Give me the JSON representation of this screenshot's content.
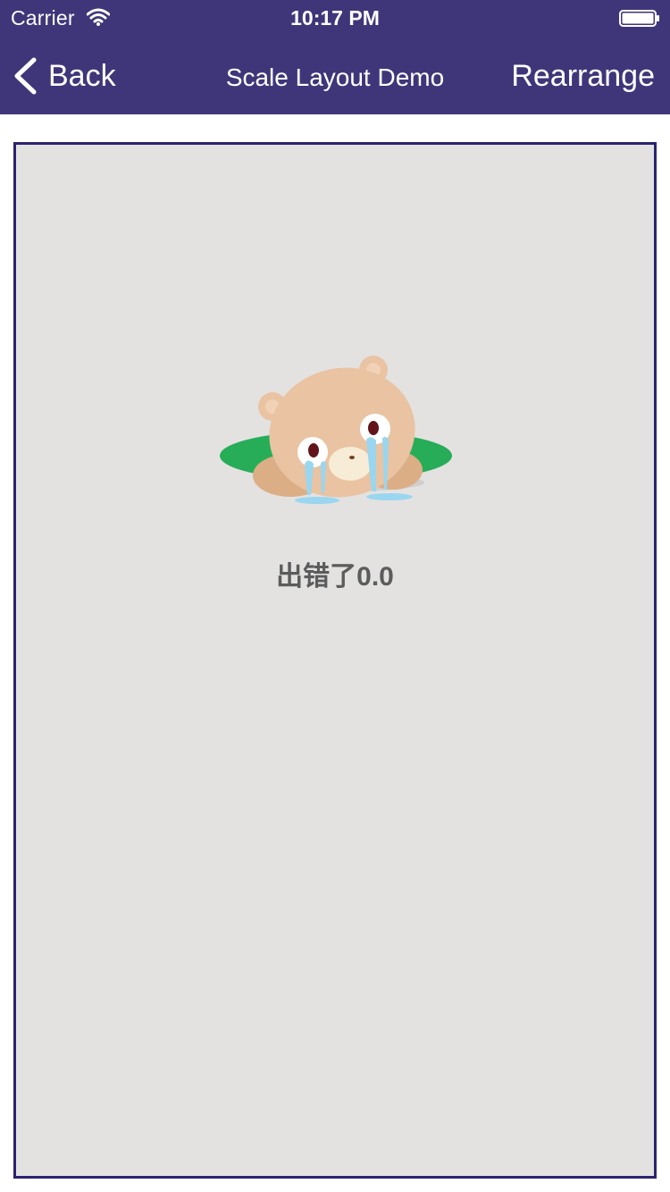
{
  "status_bar": {
    "carrier": "Carrier",
    "time": "10:17 PM",
    "wifi_icon": "wifi-icon",
    "battery_icon": "battery-icon"
  },
  "nav_bar": {
    "back_label": "Back",
    "title": "Scale Layout Demo",
    "right_action_label": "Rearrange",
    "background_color": "#3f367a"
  },
  "content": {
    "illustration": "crying-bear-illustration",
    "error_message": "出错了0.0",
    "frame_border_color": "#2b236f",
    "background_color": "#e3e2e1"
  }
}
